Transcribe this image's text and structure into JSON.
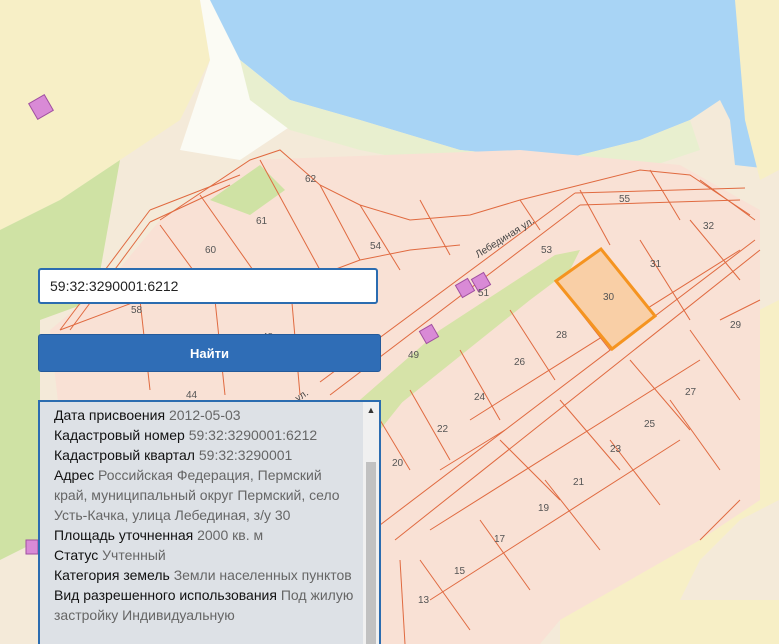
{
  "search": {
    "value": "59:32:3290001:6212"
  },
  "find_button": {
    "label": "Найти"
  },
  "colors": {
    "water": "#a8d4f5",
    "land": "#f6e2d6",
    "parcel_border": "#e06a40",
    "selected_fill": "#f9cfa6",
    "selected_border": "#f59420",
    "green": "#cfe2a4",
    "building": "#d98ad6",
    "sand": "#f7f0c9"
  },
  "map": {
    "streets": [
      "Лебединая ул.",
      "ул."
    ],
    "plots": [
      "62",
      "61",
      "60",
      "58",
      "55",
      "54",
      "53",
      "51",
      "49",
      "48",
      "44",
      "32",
      "31",
      "30",
      "29",
      "28",
      "27",
      "26",
      "25",
      "24",
      "23",
      "22",
      "21",
      "20",
      "19",
      "17",
      "15",
      "13"
    ],
    "selected_plot": "30"
  },
  "info": {
    "rows": [
      {
        "label": "Дата присвоения",
        "value": "2012-05-03"
      },
      {
        "label": "Кадастровый номер",
        "value": "59:32:3290001:6212"
      },
      {
        "label": "Кадастровый квартал",
        "value": "59:32:3290001"
      },
      {
        "label": "Адрес",
        "value": "Российская Федерация, Пермский край, муниципальный округ Пермский, село Усть-Качка, улица Лебединая, з/у 30"
      },
      {
        "label": "Площадь уточненная",
        "value": "2000 кв. м"
      },
      {
        "label": "Статус",
        "value": "Учтенный"
      },
      {
        "label": "Категория земель",
        "value": "Земли населенных пунктов"
      },
      {
        "label": "Вид разрешенного использования",
        "value": "Под жилую застройку Индивидуальную"
      }
    ]
  }
}
